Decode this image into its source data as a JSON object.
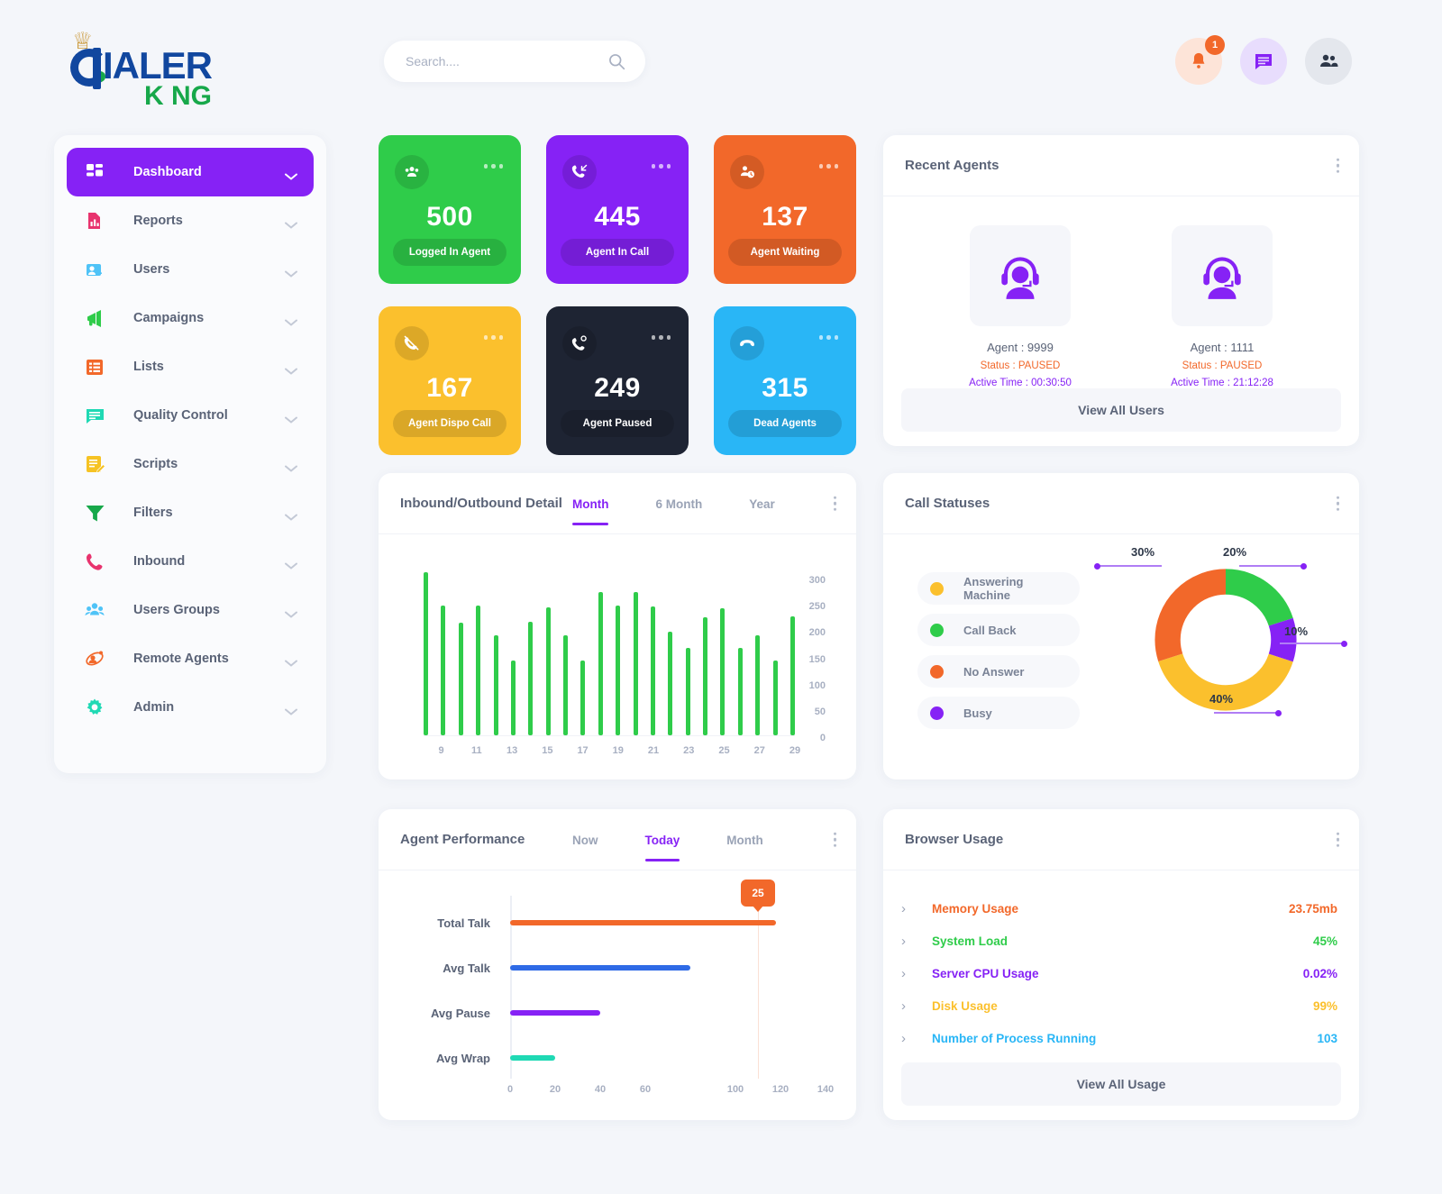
{
  "brand": {
    "line1": "IALER",
    "line2": "K NG",
    "crown": "♕"
  },
  "search": {
    "placeholder": "Search....",
    "value": ""
  },
  "topbar": {
    "notification_count": "1"
  },
  "sidebar": {
    "items": [
      {
        "label": "Dashboard",
        "icon": "grid-icon",
        "color": "#ffffff",
        "active": true
      },
      {
        "label": "Reports",
        "icon": "report-chart-icon",
        "color": "#e8336e",
        "active": false
      },
      {
        "label": "Users",
        "icon": "user-card-icon",
        "color": "#4fc3f7",
        "active": false
      },
      {
        "label": "Campaigns",
        "icon": "megaphone-icon",
        "color": "#2fcc4a",
        "active": false
      },
      {
        "label": "Lists",
        "icon": "list-icon",
        "color": "#f2682a",
        "active": false
      },
      {
        "label": "Quality Control",
        "icon": "chat-lines-icon",
        "color": "#1fd9b4",
        "active": false
      },
      {
        "label": "Scripts",
        "icon": "script-edit-icon",
        "color": "#f6c324",
        "active": false
      },
      {
        "label": "Filters",
        "icon": "funnel-icon",
        "color": "#17a84a",
        "active": false
      },
      {
        "label": "Inbound",
        "icon": "phone-icon",
        "color": "#e8336e",
        "active": false
      },
      {
        "label": "Users Groups",
        "icon": "users-group-icon",
        "color": "#4fc3f7",
        "active": false
      },
      {
        "label": "Remote Agents",
        "icon": "remote-agent-icon",
        "color": "#f2682a",
        "active": false
      },
      {
        "label": "Admin",
        "icon": "gear-icon",
        "color": "#1fd9b4",
        "active": false
      }
    ]
  },
  "tiles": [
    {
      "value": "500",
      "label": "Logged In Agent",
      "bg": "#2fcc4a",
      "icon": "group-icon"
    },
    {
      "value": "445",
      "label": "Agent In Call",
      "bg": "#8622f5",
      "icon": "phone-incoming-icon"
    },
    {
      "value": "137",
      "label": "Agent Waiting",
      "bg": "#f2682a",
      "icon": "user-clock-icon"
    },
    {
      "value": "167",
      "label": "Agent Dispo Call",
      "bg": "#fbc02d",
      "icon": "phone-missed-icon"
    },
    {
      "value": "249",
      "label": "Agent Paused",
      "bg": "#1e2433",
      "icon": "phone-pause-icon"
    },
    {
      "value": "315",
      "label": "Dead Agents",
      "bg": "#29b6f6",
      "icon": "phone-hangup-icon"
    }
  ],
  "recent_agents": {
    "title": "Recent Agents",
    "agents": [
      {
        "id": "Agent : 9999",
        "status": "Status : PAUSED",
        "active_time": "Active Time : 00:30:50"
      },
      {
        "id": "Agent : 1111",
        "status": "Status : PAUSED",
        "active_time": "Active Time : 21:12:28"
      }
    ],
    "view_all": "View All Users"
  },
  "inbound_outbound": {
    "title": "Inbound/Outbound Detail",
    "tabs": [
      {
        "label": "Month",
        "active": true
      },
      {
        "label": "6 Month",
        "active": false
      },
      {
        "label": "Year",
        "active": false
      }
    ]
  },
  "call_statuses": {
    "title": "Call Statuses",
    "legend": [
      {
        "label": "Answering Machine",
        "color": "#fbc02d"
      },
      {
        "label": "Call Back",
        "color": "#2fcc4a"
      },
      {
        "label": "No Answer",
        "color": "#f2682a"
      },
      {
        "label": "Busy",
        "color": "#8622f5"
      }
    ]
  },
  "agent_performance": {
    "title": "Agent Performance",
    "tabs": [
      {
        "label": "Now",
        "active": false
      },
      {
        "label": "Today",
        "active": true
      },
      {
        "label": "Month",
        "active": false
      }
    ],
    "tooltip": "25"
  },
  "browser_usage": {
    "title": "Browser Usage",
    "rows": [
      {
        "name": "Memory Usage",
        "value": "23.75mb",
        "color": "#f2682a"
      },
      {
        "name": "System Load",
        "value": "45%",
        "color": "#2fcc4a"
      },
      {
        "name": "Server CPU Usage",
        "value": "0.02%",
        "color": "#8622f5"
      },
      {
        "name": "Disk Usage",
        "value": "99%",
        "color": "#fbc02d"
      },
      {
        "name": "Number of Process Running",
        "value": "103",
        "color": "#29b6f6"
      }
    ],
    "view_all": "View All Usage"
  },
  "chart_data": [
    {
      "type": "bar",
      "title": "Inbound/Outbound Detail",
      "xlabel": "",
      "ylabel": "",
      "ylim": [
        0,
        300
      ],
      "yticks": [
        0,
        50,
        100,
        150,
        200,
        250,
        300
      ],
      "categories": [
        "8",
        "9",
        "10",
        "11",
        "12",
        "13",
        "14",
        "15",
        "16",
        "17",
        "18",
        "19",
        "20",
        "21",
        "22",
        "23",
        "24",
        "25",
        "26",
        "27",
        "28",
        "29"
      ],
      "xtick_labels": [
        "9",
        "11",
        "13",
        "15",
        "17",
        "19",
        "21",
        "23",
        "25",
        "27",
        "29"
      ],
      "values": [
        310,
        247,
        214,
        247,
        191,
        142,
        216,
        243,
        191,
        142,
        272,
        247,
        272,
        246,
        198,
        166,
        224,
        242,
        166,
        191,
        142,
        227
      ],
      "color": "#2fcc4a",
      "grid": false
    },
    {
      "type": "pie",
      "title": "Call Statuses",
      "labels": [
        "Call Back",
        "Busy",
        "Answering Machine",
        "No Answer"
      ],
      "values": [
        20,
        10,
        40,
        30
      ],
      "display_labels": [
        "20%",
        "10%",
        "40%",
        "30%"
      ],
      "colors": [
        "#2fcc4a",
        "#8622f5",
        "#fbc02d",
        "#f2682a"
      ],
      "legend": [
        "Answering Machine",
        "Call Back",
        "No Answer",
        "Busy"
      ],
      "legend_position": "left",
      "donut": true
    },
    {
      "type": "bar",
      "orientation": "horizontal",
      "title": "Agent Performance",
      "categories": [
        "Total Talk",
        "Avg Talk",
        "Avg Pause",
        "Avg Wrap"
      ],
      "values": [
        118,
        80,
        40,
        20
      ],
      "colors": [
        "#f2682a",
        "#2e6ae6",
        "#8622f5",
        "#1fd9b4"
      ],
      "xlim": [
        0,
        140
      ],
      "xticks": [
        0,
        20,
        40,
        60,
        100,
        120,
        140
      ],
      "xtick_labels": [
        "0",
        "20",
        "40",
        "60",
        "100",
        "120",
        "140"
      ],
      "annotation": "25",
      "grid": false
    }
  ]
}
